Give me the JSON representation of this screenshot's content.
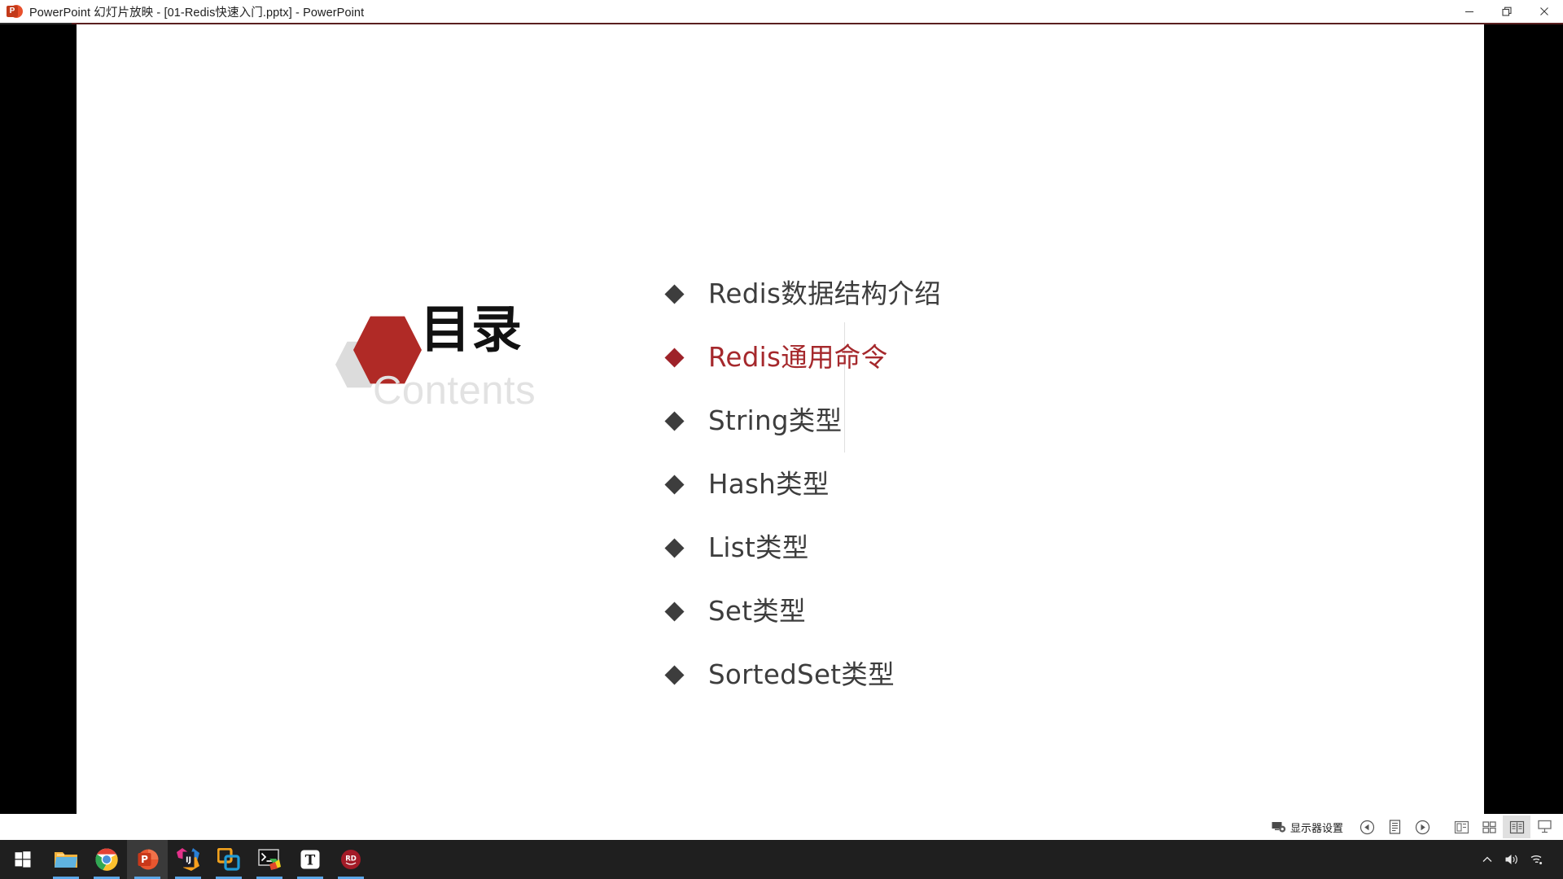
{
  "window": {
    "title": "PowerPoint 幻灯片放映 - [01-Redis快速入门.pptx] - PowerPoint",
    "app_icon_letter": "P",
    "controls": [
      {
        "name": "minimize",
        "label": "最小化"
      },
      {
        "name": "restore",
        "label": "向下还原"
      },
      {
        "name": "close",
        "label": "关闭"
      }
    ]
  },
  "slide": {
    "logo": {
      "title_cn": "目录",
      "title_en": "Contents",
      "hex_red": "#b02a26",
      "hex_gray": "#dcdcdc"
    },
    "toc": {
      "items": [
        {
          "label": "Redis数据结构介绍",
          "color": "#3d3d3d",
          "bullet_color": "#3d3d3d",
          "active": false
        },
        {
          "label": "Redis通用命令",
          "color": "#a5282c",
          "bullet_color": "#9e2229",
          "active": true
        },
        {
          "label": "String类型",
          "color": "#3d3d3d",
          "bullet_color": "#3d3d3d",
          "active": false
        },
        {
          "label": "Hash类型",
          "color": "#3d3d3d",
          "bullet_color": "#3d3d3d",
          "active": false
        },
        {
          "label": "List类型",
          "color": "#3d3d3d",
          "bullet_color": "#3d3d3d",
          "active": false
        },
        {
          "label": "Set类型",
          "color": "#3d3d3d",
          "bullet_color": "#3d3d3d",
          "active": false
        },
        {
          "label": "SortedSet类型",
          "color": "#3d3d3d",
          "bullet_color": "#3d3d3d",
          "active": false
        }
      ]
    }
  },
  "progress": {
    "filled_color": "#a5302b",
    "remaining_color": "#4d4d4d",
    "filled_percent": 89,
    "remaining_percent": 11
  },
  "statusbar": {
    "display_settings_label": "显示器设置",
    "buttons": [
      {
        "name": "previous-slide",
        "label": "上一张"
      },
      {
        "name": "notes",
        "label": "备注"
      },
      {
        "name": "next-slide",
        "label": "下一张"
      }
    ],
    "view_modes": [
      {
        "name": "normal-view",
        "label": "普通视图",
        "active": false
      },
      {
        "name": "slide-sorter-view",
        "label": "幻灯片浏览",
        "active": false
      },
      {
        "name": "reading-view",
        "label": "阅读视图",
        "active": true
      },
      {
        "name": "slide-show-view",
        "label": "幻灯片放映",
        "active": false
      }
    ]
  },
  "taskbar": {
    "start_label": "开始",
    "items": [
      {
        "name": "file-explorer",
        "label": "文件资源管理器",
        "active": false,
        "running": true
      },
      {
        "name": "google-chrome",
        "label": "Google Chrome",
        "active": false,
        "running": true
      },
      {
        "name": "powerpoint",
        "label": "PowerPoint",
        "active": true,
        "running": true
      },
      {
        "name": "intellij-idea",
        "label": "IntelliJ IDEA",
        "active": false,
        "running": true
      },
      {
        "name": "vmware",
        "label": "VMware",
        "active": false,
        "running": true
      },
      {
        "name": "cmder-terminal",
        "label": "Cmder",
        "active": false,
        "running": true
      },
      {
        "name": "typora",
        "label": "Typora",
        "active": false,
        "running": true
      },
      {
        "name": "redis-desktop",
        "label": "Redis Desktop Manager",
        "active": false,
        "running": true
      }
    ],
    "tray": [
      {
        "name": "show-hidden-icons",
        "label": "显示隐藏的图标"
      },
      {
        "name": "volume",
        "label": "音量"
      },
      {
        "name": "network",
        "label": "网络"
      }
    ]
  }
}
